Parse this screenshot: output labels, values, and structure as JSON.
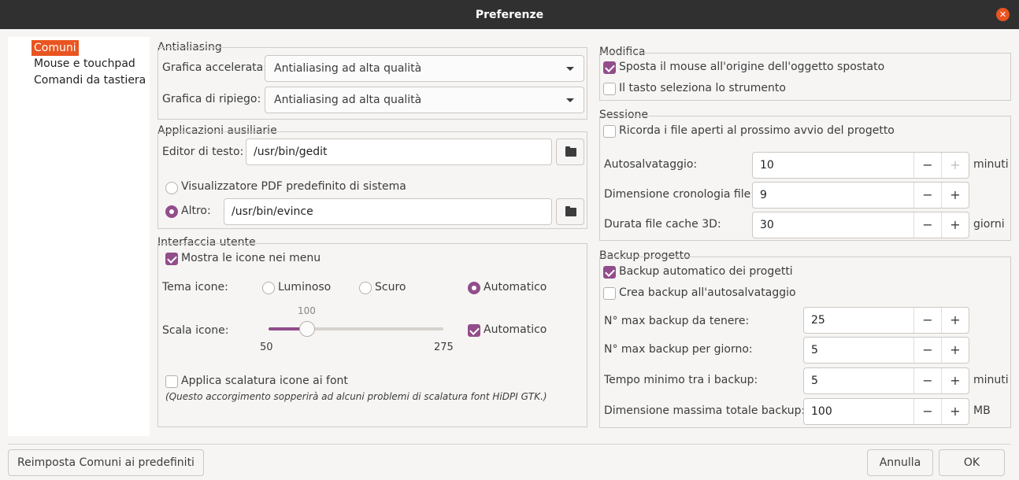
{
  "window": {
    "title": "Preferenze"
  },
  "sidebar": {
    "items": [
      "Comuni",
      "Mouse e touchpad",
      "Comandi da tastiera"
    ]
  },
  "antialiasing": {
    "title": "Antialiasing",
    "accelerated_label": "Grafica accelerata:",
    "accelerated_value": "Antialiasing ad alta qualità",
    "fallback_label": "Grafica di ripiego:",
    "fallback_value": "Antialiasing ad alta qualità"
  },
  "aux_apps": {
    "title": "Applicazioni ausiliarie",
    "text_editor_label": "Editor di testo:",
    "text_editor_value": "/usr/bin/gedit",
    "pdf_default_label": "Visualizzatore PDF predefinito di sistema",
    "pdf_other_label": "Altro:",
    "pdf_other_value": "/usr/bin/evince"
  },
  "ui": {
    "title": "Interfaccia utente",
    "show_menu_icons": "Mostra le icone nei menu",
    "icon_theme_label": "Tema icone:",
    "theme_options": [
      "Luminoso",
      "Scuro",
      "Automatico"
    ],
    "theme_selected": "Automatico",
    "icon_scale_label": "Scala icone:",
    "scale_value": "100",
    "scale_min": "50",
    "scale_max": "275",
    "scale_auto": "Automatico",
    "apply_font_scaling": "Applica scalatura icone ai font",
    "font_scaling_note": "(Questo accorgimento sopperirà ad alcuni problemi di scalatura font HiDPI GTK.)"
  },
  "editing": {
    "title": "Modifica",
    "warp_mouse": "Sposta il mouse all'origine dell'oggetto spostato",
    "key_selects_tool": "Il tasto seleziona lo strumento"
  },
  "session": {
    "title": "Sessione",
    "remember_files": "Ricorda i file aperti al prossimo avvio del progetto",
    "autosave_label": "Autosalvataggio:",
    "autosave_value": "10",
    "autosave_unit": "minuti",
    "history_label": "Dimensione cronologia file:",
    "history_value": "9",
    "cache_label": "Durata file cache 3D:",
    "cache_value": "30",
    "cache_unit": "giorni"
  },
  "backup": {
    "title": "Backup progetto",
    "auto_backup": "Backup automatico dei progetti",
    "backup_on_autosave": "Crea backup all'autosalvataggio",
    "max_backups_label": "N° max backup da tenere:",
    "max_backups_value": "25",
    "max_daily_label": "N° max backup per giorno:",
    "max_daily_value": "5",
    "min_interval_label": "Tempo minimo tra i backup:",
    "min_interval_value": "5",
    "min_interval_unit": "minuti",
    "max_size_label": "Dimensione massima totale backup:",
    "max_size_value": "100",
    "max_size_unit": "MB"
  },
  "spin": {
    "minus": "−",
    "plus": "+"
  },
  "footer": {
    "reset_button": "Reimposta Comuni ai predefiniti",
    "cancel_button": "Annulla",
    "ok_button": "OK"
  },
  "colors": {
    "accent": "#924d8b",
    "selection": "#e95420",
    "titlebar": "#303030"
  }
}
